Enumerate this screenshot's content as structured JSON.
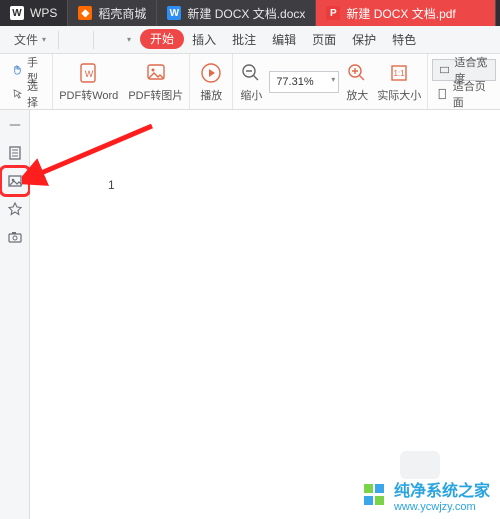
{
  "titlebar": {
    "app_label": "WPS",
    "tabs": [
      {
        "icon": "store",
        "label": "稻壳商城"
      },
      {
        "icon": "docx",
        "label": "新建 DOCX 文档.docx"
      },
      {
        "icon": "pdf",
        "label": "新建 DOCX 文档.pdf",
        "active": true
      }
    ]
  },
  "menubar": {
    "file_label": "文件",
    "items": [
      "开始",
      "插入",
      "批注",
      "编辑",
      "页面",
      "保护",
      "特色"
    ],
    "active_index": 0
  },
  "toolbar": {
    "hand_label": "手型",
    "select_label": "选择",
    "pdf2word_label": "PDF转Word",
    "pdf2image_label": "PDF转图片",
    "play_label": "播放",
    "zoomout_label": "缩小",
    "zoom_value": "77.31%",
    "zoomin_label": "放大",
    "actualsize_label": "实际大小",
    "fitwidth_label": "适合宽度",
    "fitpage_label": "适合页面"
  },
  "sidebar": {
    "items": [
      "thumbnails",
      "image-extract",
      "bookmark",
      "camera"
    ],
    "highlighted_index": 1
  },
  "page": {
    "number": "1"
  },
  "watermark": {
    "title": "纯净系统之家",
    "url": "www.ycwjzy.com"
  }
}
